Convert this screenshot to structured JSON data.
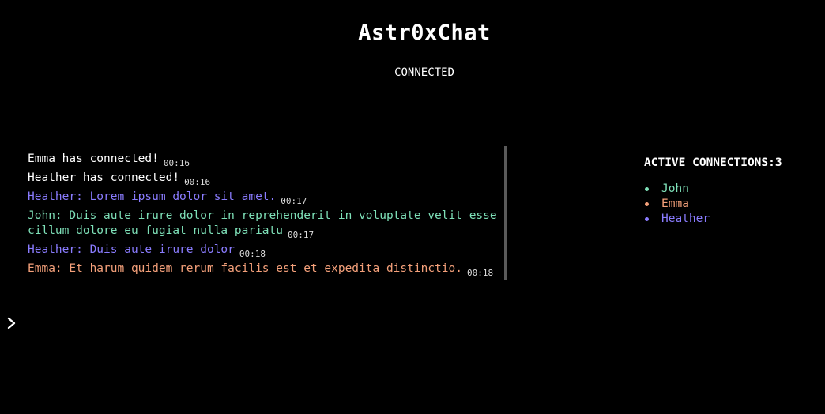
{
  "header": {
    "title": "Astr0xChat",
    "status": "CONNECTED"
  },
  "chat": {
    "messages": [
      {
        "text": "Emma has connected!",
        "time": "00:16",
        "color": "#ffffff"
      },
      {
        "text": "Heather has connected!",
        "time": "00:16",
        "color": "#ffffff"
      },
      {
        "text": "Heather: Lorem ipsum dolor sit amet.",
        "time": "00:17",
        "color": "#8a7cff"
      },
      {
        "text": "John: Duis aute irure dolor in reprehenderit in voluptate velit esse cillum dolore eu fugiat nulla pariatu",
        "time": "00:17",
        "color": "#7ee0b8"
      },
      {
        "text": "Heather: Duis aute irure dolor",
        "time": "00:18",
        "color": "#8a7cff"
      },
      {
        "text": "Emma: Et harum quidem rerum facilis est et expedita distinctio.",
        "time": "00:18",
        "color": "#f4a07a"
      }
    ]
  },
  "sidebar": {
    "title": "ACTIVE CONNECTIONS:3",
    "users": [
      {
        "name": "John",
        "color": "#7ee0b8"
      },
      {
        "name": "Emma",
        "color": "#f4a07a"
      },
      {
        "name": "Heather",
        "color": "#8a7cff"
      }
    ]
  },
  "input": {
    "prompt_icon": "chevron-right-icon",
    "value": "",
    "placeholder": ""
  }
}
